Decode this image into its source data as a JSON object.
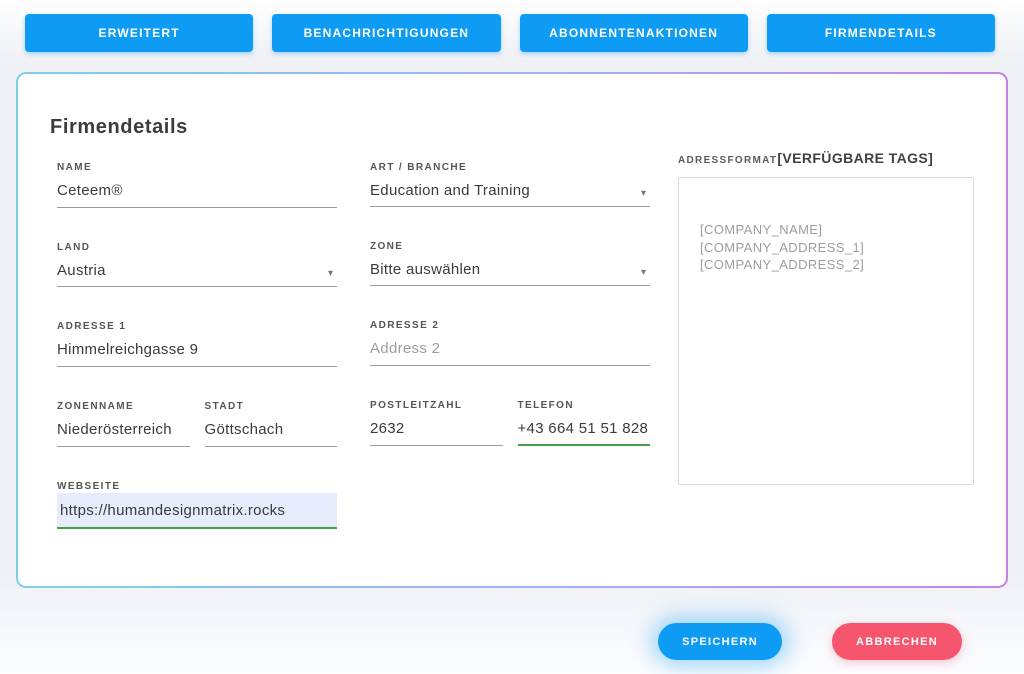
{
  "tabs": [
    {
      "label": "ERWEITERT"
    },
    {
      "label": "BENACHRICHTIGUNGEN"
    },
    {
      "label": "ABONNENTENAKTIONEN"
    },
    {
      "label": "FIRMENDETAILS"
    }
  ],
  "form": {
    "title": "Firmendetails",
    "fields": {
      "name": {
        "label": "NAME",
        "value": "Ceteem®"
      },
      "branch": {
        "label": "ART / BRANCHE",
        "value": "Education and Training"
      },
      "country": {
        "label": "LAND",
        "value": "Austria"
      },
      "zone": {
        "label": "ZONE",
        "value": "Bitte auswählen"
      },
      "address1": {
        "label": "ADRESSE 1",
        "value": "Himmelreichgasse 9"
      },
      "address2": {
        "label": "ADRESSE 2",
        "placeholder": "Address 2"
      },
      "zonename": {
        "label": "ZONENNAME",
        "value": "Niederösterreich"
      },
      "city": {
        "label": "STADT",
        "value": "Göttschach"
      },
      "postcode": {
        "label": "POSTLEITZAHL",
        "value": "2632"
      },
      "phone": {
        "label": "TELEFON",
        "value": "+43 664 51 51 828"
      },
      "website": {
        "label": "WEBSEITE",
        "value": "https://humandesignmatrix.rocks"
      }
    },
    "address_format": {
      "label_prefix": "ADRESSFORMAT",
      "label_tags": "[VERFÜGBARE TAGS]",
      "tags": [
        "[COMPANY_NAME]",
        "[COMPANY_ADDRESS_1]",
        "[COMPANY_ADDRESS_2]"
      ]
    }
  },
  "actions": {
    "save": "SPEICHERN",
    "cancel": "ABBRECHEN"
  },
  "icons": {
    "dropdown_arrow": "▾"
  },
  "colors": {
    "accent_blue": "#0d9bf4",
    "danger_pink": "#f5566e",
    "valid_green": "#43a047",
    "autofill_bg": "#e7ecfc",
    "border_gradient_left": "#7fcde9",
    "border_gradient_right": "#c583e2"
  }
}
